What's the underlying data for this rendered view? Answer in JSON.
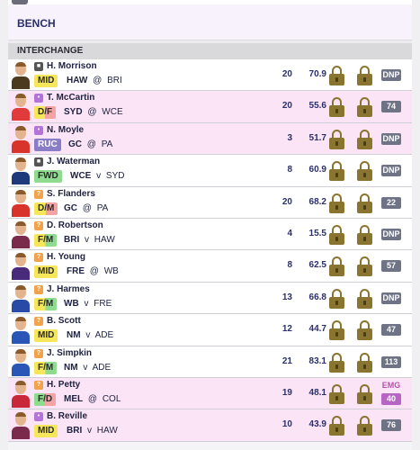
{
  "bench_title": "BENCH",
  "interchange_title": "INTERCHANGE",
  "players": [
    {
      "name": "H. Morrison",
      "pos": "MID",
      "pos_class": "MID",
      "team": "HAW",
      "sep": "@",
      "opp": "BRI",
      "games": "20",
      "avg": "70.9",
      "status": "DNP",
      "badge": "lock-icon",
      "pink": false,
      "jersey": "#4b3a1e"
    },
    {
      "name": "T. McCartin",
      "pos": "D/F",
      "pos_class": "DF",
      "team": "SYD",
      "sep": "@",
      "opp": "WCE",
      "games": "20",
      "avg": "55.6",
      "status": "74",
      "badge": "purple",
      "pink": true,
      "jersey": "#e03a3a"
    },
    {
      "name": "N. Moyle",
      "pos": "RUC",
      "pos_class": "RUC",
      "team": "GC",
      "sep": "@",
      "opp": "PA",
      "games": "3",
      "avg": "51.7",
      "status": "DNP",
      "badge": "purple",
      "pink": true,
      "jersey": "#d9342b"
    },
    {
      "name": "J. Waterman",
      "pos": "FWD",
      "pos_class": "FWD",
      "team": "WCE",
      "sep": "v",
      "opp": "SYD",
      "games": "8",
      "avg": "60.9",
      "status": "DNP",
      "badge": "lock-icon",
      "pink": false,
      "jersey": "#1f3a7a"
    },
    {
      "name": "S. Flanders",
      "pos": "D/M",
      "pos_class": "DM",
      "team": "GC",
      "sep": "@",
      "opp": "PA",
      "games": "20",
      "avg": "68.2",
      "status": "22",
      "badge": "orange",
      "pink": false,
      "jersey": "#d9342b"
    },
    {
      "name": "D. Robertson",
      "pos": "F/M",
      "pos_class": "FM",
      "team": "BRI",
      "sep": "v",
      "opp": "HAW",
      "games": "4",
      "avg": "15.5",
      "status": "DNP",
      "badge": "orange",
      "pink": false,
      "jersey": "#7a2a4a"
    },
    {
      "name": "H. Young",
      "pos": "MID",
      "pos_class": "MID",
      "team": "FRE",
      "sep": "@",
      "opp": "WB",
      "games": "8",
      "avg": "62.5",
      "status": "57",
      "badge": "orange",
      "pink": false,
      "jersey": "#4a2a7a"
    },
    {
      "name": "J. Harmes",
      "pos": "F/M",
      "pos_class": "FM",
      "team": "WB",
      "sep": "v",
      "opp": "FRE",
      "games": "13",
      "avg": "66.8",
      "status": "DNP",
      "badge": "orange",
      "pink": false,
      "jersey": "#2a4aa8"
    },
    {
      "name": "B. Scott",
      "pos": "MID",
      "pos_class": "MID",
      "team": "NM",
      "sep": "v",
      "opp": "ADE",
      "games": "12",
      "avg": "44.7",
      "status": "47",
      "badge": "orange",
      "pink": false,
      "jersey": "#2a56b8"
    },
    {
      "name": "J. Simpkin",
      "pos": "F/M",
      "pos_class": "FM",
      "team": "NM",
      "sep": "v",
      "opp": "ADE",
      "games": "21",
      "avg": "83.1",
      "status": "113",
      "badge": "orange",
      "pink": false,
      "jersey": "#2a56b8"
    },
    {
      "name": "H. Petty",
      "pos": "F/D",
      "pos_class": "FD",
      "team": "MEL",
      "sep": "@",
      "opp": "COL",
      "games": "19",
      "avg": "48.1",
      "status": "40",
      "emg": "EMG",
      "badge": "orange",
      "pink": true,
      "jersey": "#c8283a"
    },
    {
      "name": "B. Reville",
      "pos": "MID",
      "pos_class": "MID",
      "team": "BRI",
      "sep": "v",
      "opp": "HAW",
      "games": "10",
      "avg": "43.9",
      "status": "76",
      "badge": "purple",
      "pink": true,
      "jersey": "#7a2a4a"
    }
  ]
}
